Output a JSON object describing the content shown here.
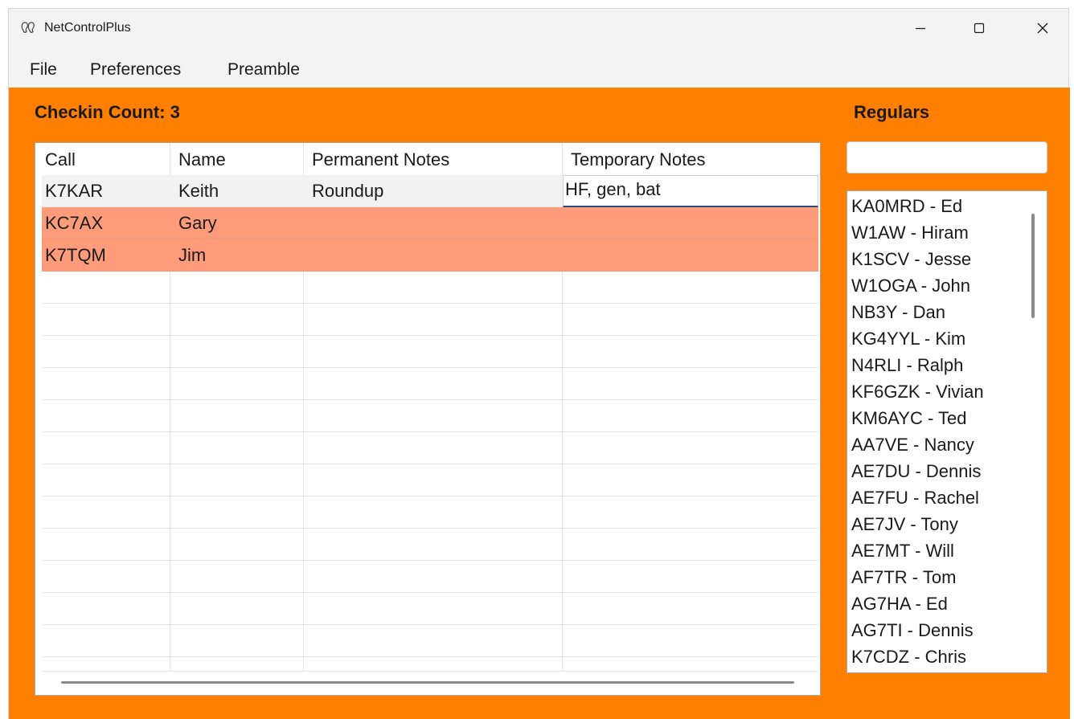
{
  "window": {
    "title": "NetControlPlus",
    "icon": "app-ears-icon",
    "controls": [
      "minimize-icon",
      "maximize-icon",
      "close-icon"
    ]
  },
  "menu": {
    "file": "File",
    "preferences": "Preferences",
    "preamble": "Preamble"
  },
  "checkin_count_label": "Checkin Count: 3",
  "grid": {
    "columns": [
      "Call",
      "Name",
      "Permanent Notes",
      "Temporary Notes"
    ],
    "rows": [
      {
        "call": "K7KAR",
        "name": "Keith",
        "permanent": "Roundup",
        "temporary": "HF, gen, bat",
        "state": "selected-editing"
      },
      {
        "call": "KC7AX",
        "name": "Gary",
        "permanent": "",
        "temporary": "",
        "state": "highlighted"
      },
      {
        "call": "K7TQM",
        "name": "Jim",
        "permanent": "",
        "temporary": "",
        "state": "highlighted"
      }
    ]
  },
  "regulars": {
    "title": "Regulars",
    "search_value": "",
    "items": [
      "KA0MRD - Ed",
      "W1AW - Hiram",
      "K1SCV - Jesse",
      "W1OGA - John",
      "NB3Y - Dan",
      "KG4YYL - Kim",
      "N4RLI - Ralph",
      "KF6GZK - Vivian",
      "KM6AYC - Ted",
      "AA7VE - Nancy",
      "AE7DU - Dennis",
      "AE7FU - Rachel",
      "AE7JV - Tony",
      "AE7MT - Will",
      "AF7TR - Tom",
      "AG7HA - Ed",
      "AG7TI - Dennis",
      "K7CDZ - Chris"
    ]
  },
  "colors": {
    "background": "#ff7f00",
    "highlight_row": "#fe9b7b",
    "selected_row": "#f2f2f2",
    "edit_underline": "#2a4b7c"
  }
}
